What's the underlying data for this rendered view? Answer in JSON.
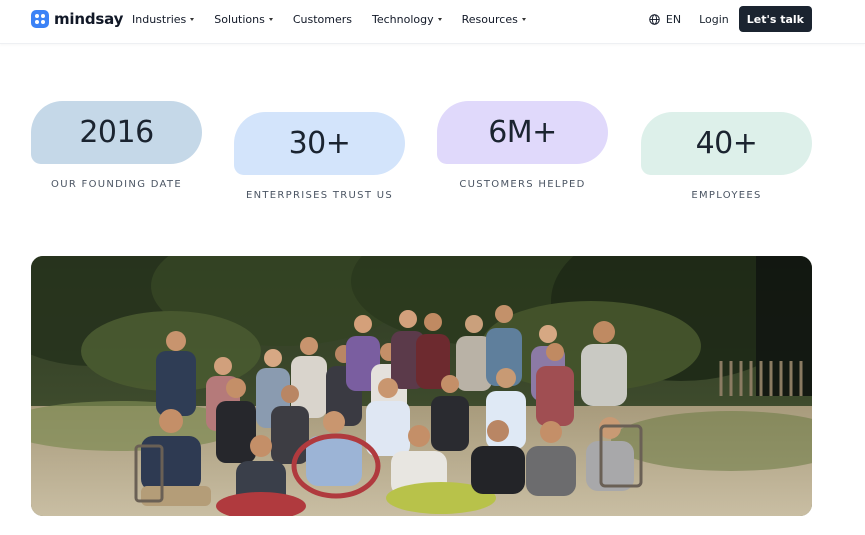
{
  "nav": {
    "brand": "mindsay",
    "menu": [
      {
        "label": "Industries",
        "has_dropdown": true
      },
      {
        "label": "Solutions",
        "has_dropdown": true
      },
      {
        "label": "Customers",
        "has_dropdown": false
      },
      {
        "label": "Technology",
        "has_dropdown": true
      },
      {
        "label": "Resources",
        "has_dropdown": true
      }
    ],
    "language": "EN",
    "login": "Login",
    "cta": "Let's talk"
  },
  "stats": [
    {
      "value": "2016",
      "label": "OUR FOUNDING DATE",
      "color": "#c5d8e8"
    },
    {
      "value": "30+",
      "label": "ENTERPRISES TRUST US",
      "color": "#d3e4fb"
    },
    {
      "value": "6M+",
      "label": "CUSTOMERS HELPED",
      "color": "#e0d9fb"
    },
    {
      "value": "40+",
      "label": "EMPLOYEES",
      "color": "#ddf0ea"
    }
  ],
  "photo": {
    "subject": "team-group-photo"
  },
  "colors": {
    "accent": "#3b82f6",
    "dark": "#1b2430"
  }
}
